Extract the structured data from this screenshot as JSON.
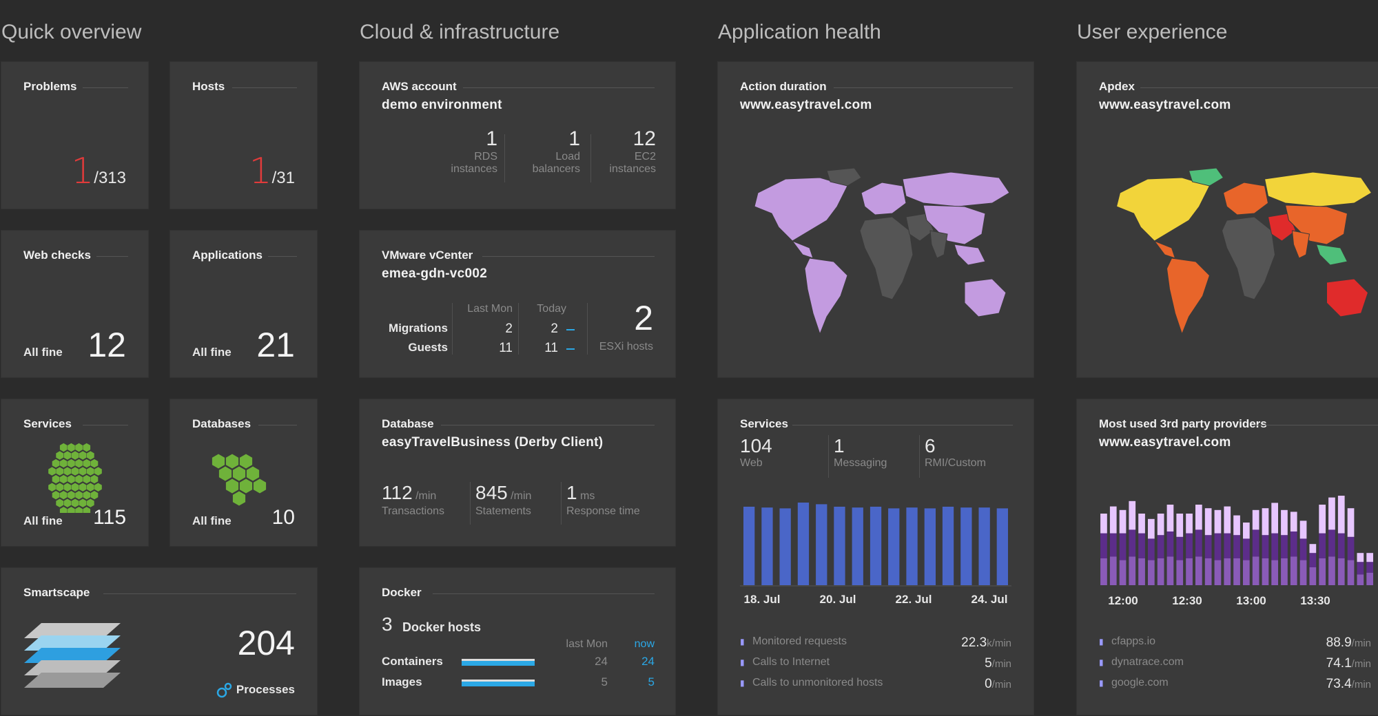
{
  "sections": {
    "quick_overview": "Quick overview",
    "cloud": "Cloud & infrastructure",
    "app_health": "Application health",
    "user_exp": "User experience"
  },
  "colors": {
    "tile_bg": "#3a3a3a",
    "page_bg": "#2b2b2b",
    "problem_red": "#e03b3b",
    "accent_blue": "#2ba8e6",
    "hex_green": "#6fb23a",
    "map_purple": "#c39be0",
    "bar_blue": "#4a66c8"
  },
  "problems": {
    "title": "Problems",
    "count": "1",
    "total": "/313"
  },
  "hosts": {
    "title": "Hosts",
    "count": "1",
    "total": "/31"
  },
  "web_checks": {
    "title": "Web checks",
    "status": "All fine",
    "value": "12"
  },
  "applications": {
    "title": "Applications",
    "status": "All fine",
    "value": "21"
  },
  "services_small": {
    "title": "Services",
    "status": "All fine",
    "value": "115",
    "icon": "hexagon-cluster-icon"
  },
  "databases": {
    "title": "Databases",
    "status": "All fine",
    "value": "10",
    "icon": "hexagon-cluster-icon"
  },
  "smartscape": {
    "title": "Smartscape",
    "value": "204",
    "label": "Processes",
    "icon": "layers-icon"
  },
  "aws": {
    "title": "AWS account",
    "name": "demo environment",
    "metrics": [
      {
        "value": "1",
        "label1": "RDS",
        "label2": "instances"
      },
      {
        "value": "1",
        "label1": "Load",
        "label2": "balancers"
      },
      {
        "value": "12",
        "label1": "EC2",
        "label2": "instances"
      }
    ]
  },
  "vmware": {
    "title": "VMware vCenter",
    "name": "emea-gdn-vc002",
    "col_last": "Last Mon",
    "col_today": "Today",
    "rows": [
      {
        "label": "Migrations",
        "last": "2",
        "today": "2"
      },
      {
        "label": "Guests",
        "last": "11",
        "today": "11"
      }
    ],
    "esxi_value": "2",
    "esxi_label": "ESXi hosts"
  },
  "database": {
    "title": "Database",
    "name": "easyTravelBusiness (Derby Client)",
    "metrics": [
      {
        "value": "112",
        "unit": "/min",
        "label": "Transactions"
      },
      {
        "value": "845",
        "unit": "/min",
        "label": "Statements"
      },
      {
        "value": "1",
        "unit": "ms",
        "label": "Response time"
      }
    ]
  },
  "docker": {
    "title": "Docker",
    "hosts_value": "3",
    "hosts_label": "Docker hosts",
    "col_last": "last Mon",
    "col_now": "now",
    "rows": [
      {
        "label": "Containers",
        "last": "24",
        "now": "24"
      },
      {
        "label": "Images",
        "last": "5",
        "now": "5"
      }
    ]
  },
  "action_duration": {
    "title": "Action duration",
    "site": "www.easytravel.com"
  },
  "apdex": {
    "title": "Apdex",
    "site": "www.easytravel.com"
  },
  "services_big": {
    "title": "Services",
    "metrics": [
      {
        "value": "104",
        "label": "Web"
      },
      {
        "value": "1",
        "label": "Messaging"
      },
      {
        "value": "6",
        "label": "RMI/Custom"
      }
    ],
    "x_labels": [
      "18. Jul",
      "20. Jul",
      "22. Jul",
      "24. Jul"
    ],
    "bars": [
      0.95,
      0.94,
      0.93,
      1.0,
      0.98,
      0.95,
      0.94,
      0.95,
      0.93,
      0.94,
      0.93,
      0.95,
      0.94,
      0.94,
      0.93
    ],
    "legend": [
      {
        "label": "Monitored requests",
        "value": "22.3",
        "unit": "k/min"
      },
      {
        "label": "Calls to Internet",
        "value": "5",
        "unit": "/min"
      },
      {
        "label": "Calls to unmonitored hosts",
        "value": "0",
        "unit": "/min"
      }
    ]
  },
  "third_party": {
    "title": "Most used 3rd party providers",
    "site": "www.easytravel.com",
    "x_labels": [
      "12:00",
      "12:30",
      "13:00",
      "13:30"
    ],
    "stacks": [
      [
        0.3,
        0.28,
        0.22
      ],
      [
        0.32,
        0.26,
        0.3
      ],
      [
        0.28,
        0.3,
        0.26
      ],
      [
        0.32,
        0.3,
        0.32
      ],
      [
        0.3,
        0.28,
        0.22
      ],
      [
        0.28,
        0.24,
        0.22
      ],
      [
        0.3,
        0.26,
        0.24
      ],
      [
        0.32,
        0.28,
        0.3
      ],
      [
        0.28,
        0.26,
        0.26
      ],
      [
        0.3,
        0.28,
        0.22
      ],
      [
        0.32,
        0.3,
        0.28
      ],
      [
        0.3,
        0.26,
        0.3
      ],
      [
        0.28,
        0.3,
        0.26
      ],
      [
        0.3,
        0.28,
        0.3
      ],
      [
        0.3,
        0.26,
        0.22
      ],
      [
        0.28,
        0.24,
        0.18
      ],
      [
        0.32,
        0.3,
        0.22
      ],
      [
        0.3,
        0.26,
        0.3
      ],
      [
        0.28,
        0.3,
        0.34
      ],
      [
        0.3,
        0.26,
        0.28
      ],
      [
        0.32,
        0.28,
        0.22
      ],
      [
        0.28,
        0.24,
        0.2
      ],
      [
        0.2,
        0.16,
        0.1
      ],
      [
        0.3,
        0.28,
        0.32
      ],
      [
        0.32,
        0.3,
        0.36
      ],
      [
        0.3,
        0.28,
        0.42
      ],
      [
        0.28,
        0.26,
        0.32
      ],
      [
        0.12,
        0.14,
        0.1
      ],
      [
        0.14,
        0.12,
        0.1
      ]
    ],
    "legend": [
      {
        "label": "cfapps.io",
        "value": "88.9",
        "unit": "/min"
      },
      {
        "label": "dynatrace.com",
        "value": "74.1",
        "unit": "/min"
      },
      {
        "label": "google.com",
        "value": "73.4",
        "unit": "/min"
      }
    ]
  }
}
